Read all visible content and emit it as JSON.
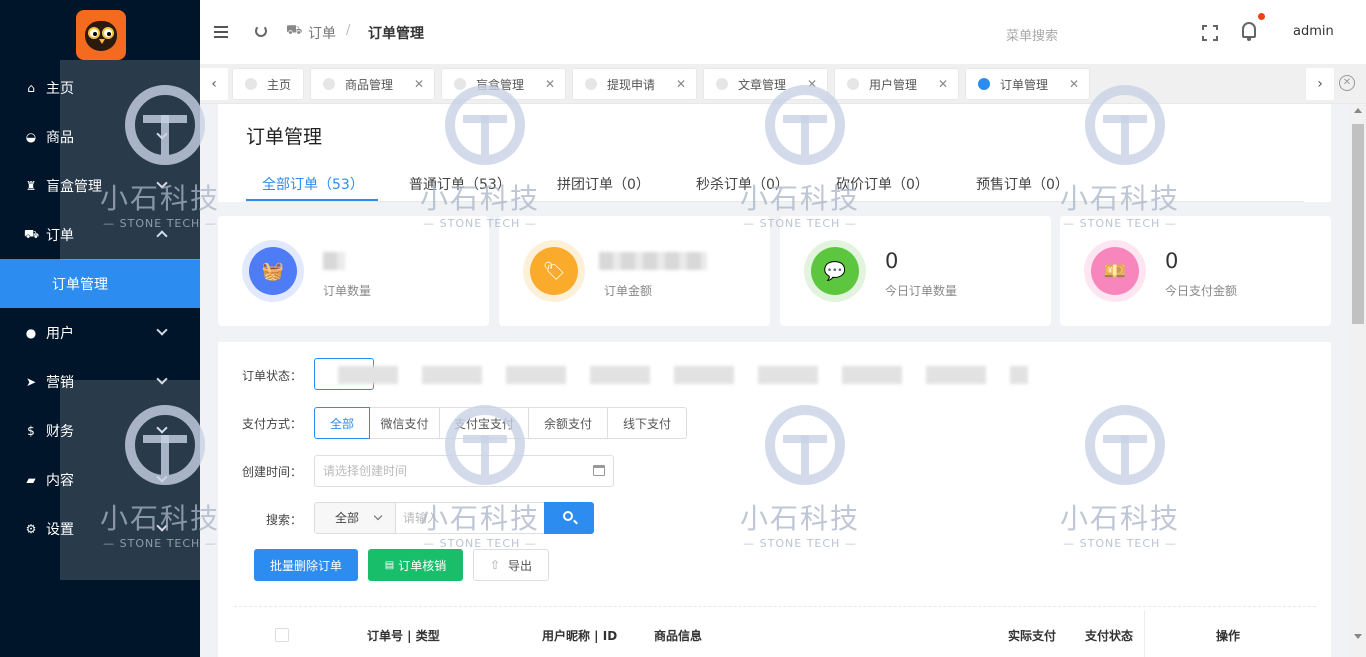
{
  "sidebar": {
    "items": [
      {
        "label": "主页",
        "icon": "home-icon"
      },
      {
        "label": "商品",
        "icon": "basket-icon"
      },
      {
        "label": "盲盒管理",
        "icon": "trophy-icon"
      },
      {
        "label": "订单",
        "icon": "cart-icon",
        "expanded": true,
        "sub": "订单管理"
      },
      {
        "label": "用户",
        "icon": "user-icon"
      },
      {
        "label": "营销",
        "icon": "send-icon"
      },
      {
        "label": "财务",
        "icon": "dollar-icon"
      },
      {
        "label": "内容",
        "icon": "book-icon"
      },
      {
        "label": "设置",
        "icon": "gear-icon"
      }
    ]
  },
  "header": {
    "breadcrumb": [
      "订单",
      "订单管理"
    ],
    "menu_search_placeholder": "菜单搜索",
    "username": "admin"
  },
  "tabs": [
    {
      "label": "主页",
      "closable": false
    },
    {
      "label": "商品管理",
      "closable": true
    },
    {
      "label": "盲盒管理",
      "closable": true
    },
    {
      "label": "提现申请",
      "closable": true
    },
    {
      "label": "文章管理",
      "closable": true
    },
    {
      "label": "用户管理",
      "closable": true
    },
    {
      "label": "订单管理",
      "closable": true,
      "active": true
    }
  ],
  "page": {
    "title": "订单管理",
    "order_tabs": [
      {
        "label": "全部订单（53）",
        "active": true
      },
      {
        "label": "普通订单（53）"
      },
      {
        "label": "拼团订单（0）"
      },
      {
        "label": "秒杀订单（0）"
      },
      {
        "label": "砍价订单（0）"
      },
      {
        "label": "预售订单（0）"
      }
    ]
  },
  "stats": [
    {
      "label": "订单数量",
      "value": "",
      "color": "#4e7cf6"
    },
    {
      "label": "订单金额",
      "value": "",
      "color": "#fbab2c"
    },
    {
      "label": "今日订单数量",
      "value": "0",
      "color": "#5bc63e"
    },
    {
      "label": "今日支付金额",
      "value": "0",
      "color": "#f786bd"
    }
  ],
  "filters": {
    "status_label": "订单状态：",
    "payment_label": "支付方式：",
    "payment_options": [
      "全部",
      "微信支付",
      "支付宝支付",
      "余额支付",
      "线下支付"
    ],
    "payment_selected": "全部",
    "date_label": "创建时间：",
    "date_placeholder": "请选择创建时间",
    "search_label": "搜索：",
    "search_scope": "全部",
    "search_placeholder": "请输入"
  },
  "actions": {
    "batch_delete": "批量删除订单",
    "verify": "订单核销",
    "export": "导出"
  },
  "table": {
    "headers": [
      "订单号 | 类型",
      "用户昵称 | ID",
      "商品信息",
      "实际支付",
      "支付状态",
      "操作"
    ]
  },
  "watermark": {
    "text": "小石科技",
    "sub": "— STONE TECH —"
  }
}
